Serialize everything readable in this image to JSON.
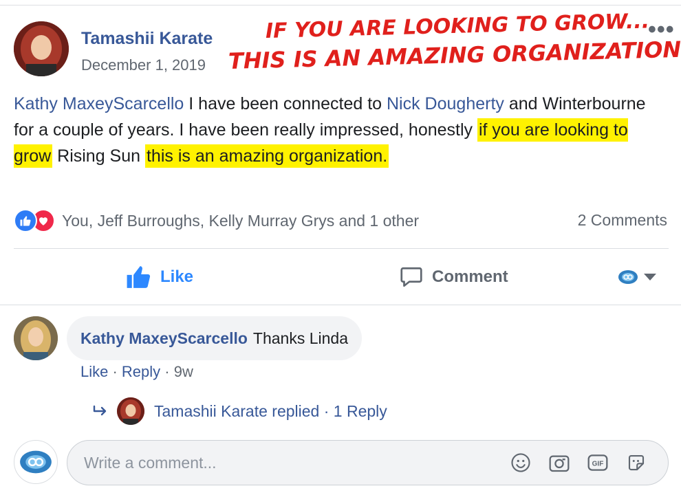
{
  "post": {
    "author": "Tamashii Karate",
    "date": "December 1, 2019",
    "more": "•••",
    "annotation_line1": "If you are looking to grow...",
    "annotation_line2": "This is an amazing organization",
    "text": {
      "mention1": "Kathy MaxeyScarcello",
      "seg1": " I have been connected to ",
      "mention2": "Nick Dougherty",
      "seg2": " and Winterbourne for a couple of years. I have been really impressed, honestly ",
      "hl1": "if you are looking to grow",
      "seg3": " Rising Sun ",
      "hl2": "this is an amazing organization."
    }
  },
  "reactions": {
    "summary": "You, Jeff Burroughs, Kelly Murray Grys and 1 other",
    "comments_count": "2 Comments"
  },
  "actions": {
    "like": "Like",
    "comment": "Comment"
  },
  "comment": {
    "author": "Kathy MaxeyScarcello",
    "text": "Thanks Linda",
    "like": "Like",
    "reply": "Reply",
    "sep": " · ",
    "age": "9w"
  },
  "replies": {
    "text": "Tamashii Karate replied · 1 Reply"
  },
  "composer": {
    "placeholder": "Write a comment..."
  },
  "colors": {
    "link": "#385898",
    "like_blue": "#2d88ff",
    "love_red": "#f0284a",
    "highlight": "#fff200",
    "annotation_red": "#e0201c"
  }
}
